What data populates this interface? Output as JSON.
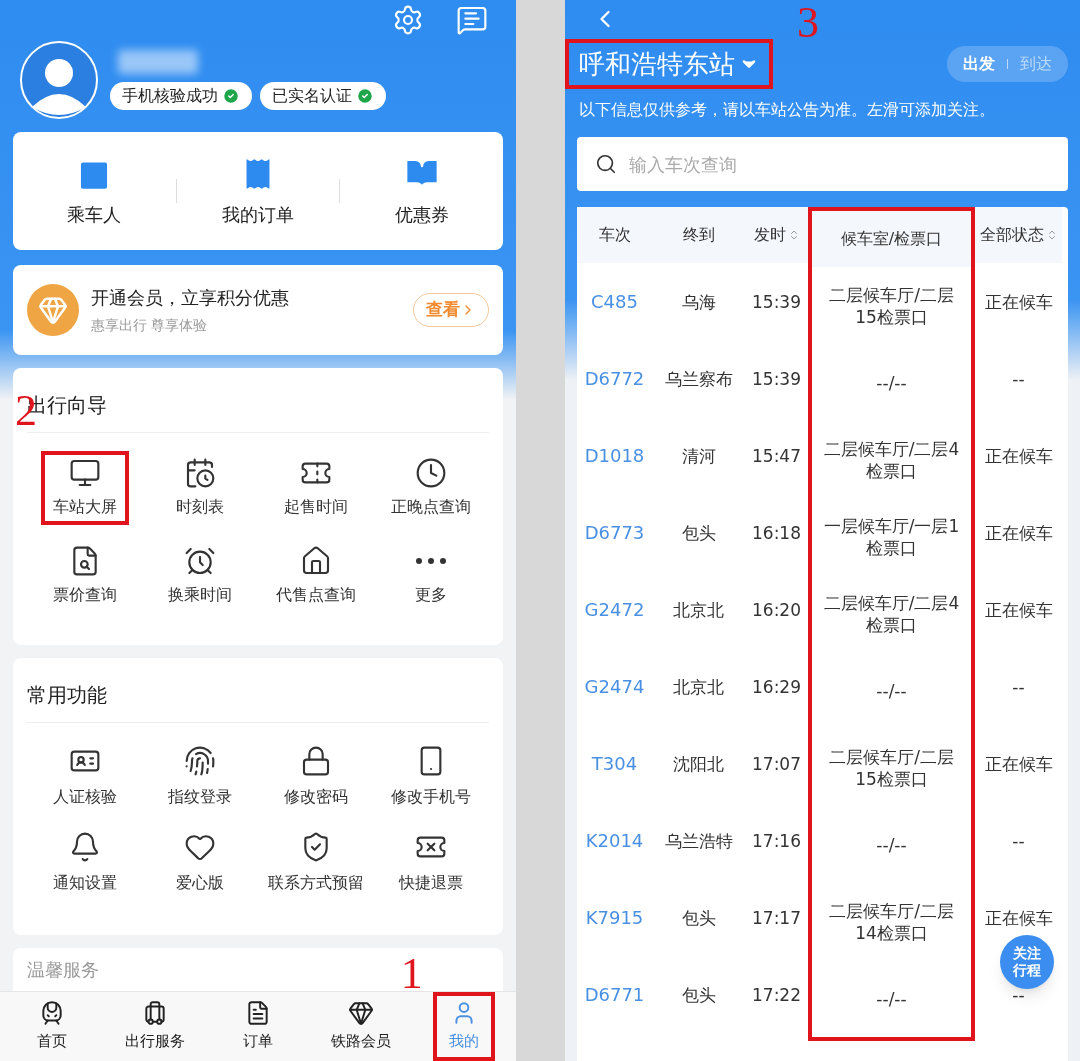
{
  "left_screen": {
    "profile": {
      "badges": [
        {
          "label": "手机核验成功"
        },
        {
          "label": "已实名认证"
        }
      ]
    },
    "shortcuts": [
      "乘车人",
      "我的订单",
      "优惠券"
    ],
    "membership": {
      "title": "开通会员，立享积分优惠",
      "subtitle": "惠享出行 尊享体验",
      "button": "查看"
    },
    "travel_guide": {
      "title": "出行向导",
      "items": [
        {
          "label": "车站大屏",
          "highlighted": true,
          "annotation": "2"
        },
        {
          "label": "时刻表",
          "highlighted": false
        },
        {
          "label": "起售时间",
          "highlighted": false
        },
        {
          "label": "正晚点查询",
          "highlighted": false
        },
        {
          "label": "票价查询",
          "highlighted": false
        },
        {
          "label": "换乘时间",
          "highlighted": false
        },
        {
          "label": "代售点查询",
          "highlighted": false
        },
        {
          "label": "更多",
          "highlighted": false
        }
      ]
    },
    "common_functions": {
      "title": "常用功能",
      "items": [
        "人证核验",
        "指纹登录",
        "修改密码",
        "修改手机号",
        "通知设置",
        "爱心版",
        "联系方式预留",
        "快捷退票"
      ]
    },
    "warm_service": {
      "title": "温馨服务"
    },
    "bottom_nav": [
      {
        "label": "首页",
        "selected": false,
        "highlighted": false
      },
      {
        "label": "出行服务",
        "selected": false,
        "highlighted": false
      },
      {
        "label": "订单",
        "selected": false,
        "highlighted": false
      },
      {
        "label": "铁路会员",
        "selected": false,
        "highlighted": false
      },
      {
        "label": "我的",
        "selected": true,
        "highlighted": true,
        "annotation": "1"
      }
    ]
  },
  "right_screen": {
    "station": {
      "label": "呼和浩特东站",
      "highlighted": true,
      "annotation": "3"
    },
    "direction_toggle": [
      {
        "label": "出发",
        "selected": true
      },
      {
        "label": "到达",
        "selected": false
      }
    ],
    "notice": "以下信息仅供参考，请以车站公告为准。左滑可添加关注。",
    "search": {
      "placeholder": "输入车次查询"
    },
    "table": {
      "columns": [
        {
          "label": "车次",
          "sortable": false,
          "highlighted": false
        },
        {
          "label": "终到",
          "sortable": false,
          "highlighted": false
        },
        {
          "label": "发时",
          "sortable": true,
          "highlighted": false
        },
        {
          "label": "候车室/检票口",
          "sortable": false,
          "highlighted": true
        },
        {
          "label": "全部状态",
          "sortable": true,
          "highlighted": false
        }
      ],
      "rows": [
        [
          "C485",
          "乌海",
          "15:39",
          "二层候车厅/二层\n15检票口",
          "正在候车"
        ],
        [
          "D6772",
          "乌兰察布",
          "15:39",
          "--/--",
          "--"
        ],
        [
          "D1018",
          "清河",
          "15:47",
          "二层候车厅/二层4\n检票口",
          "正在候车"
        ],
        [
          "D6773",
          "包头",
          "16:18",
          "一层候车厅/一层1\n检票口",
          "正在候车"
        ],
        [
          "G2472",
          "北京北",
          "16:20",
          "二层候车厅/二层4\n检票口",
          "正在候车"
        ],
        [
          "G2474",
          "北京北",
          "16:29",
          "--/--",
          "--"
        ],
        [
          "T304",
          "沈阳北",
          "17:07",
          "二层候车厅/二层\n15检票口",
          "正在候车"
        ],
        [
          "K2014",
          "乌兰浩特",
          "17:16",
          "--/--",
          "--"
        ],
        [
          "K7915",
          "包头",
          "17:17",
          "二层候车厅/二层\n14检票口",
          "正在候车"
        ],
        [
          "D6771",
          "包头",
          "17:22",
          "--/--",
          "--"
        ]
      ]
    },
    "follow_button": "关注行程"
  }
}
